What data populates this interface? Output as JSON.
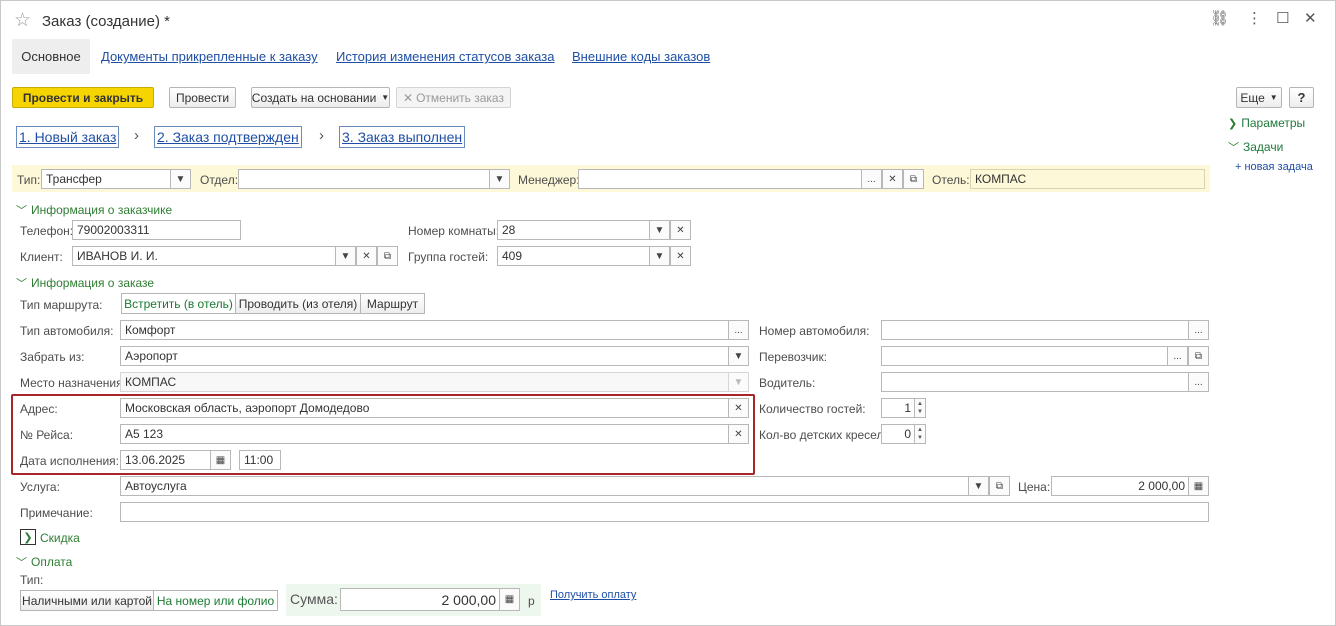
{
  "window": {
    "title": "Заказ (создание) *"
  },
  "tabs": [
    {
      "label": "Основное"
    },
    {
      "label": "Документы прикрепленные к заказу"
    },
    {
      "label": "История изменения статусов заказа"
    },
    {
      "label": "Внешние коды заказов"
    }
  ],
  "toolbar": {
    "post_close": "Провести и закрыть",
    "post": "Провести",
    "create_based": "Создать на основании",
    "cancel_order": "Отменить заказ",
    "more": "Еще",
    "help": "?"
  },
  "steps": [
    "1. Новый заказ",
    "2. Заказ подтвержден",
    "3. Заказ выполнен"
  ],
  "side_panel": {
    "params": "Параметры",
    "tasks": "Задачи",
    "new_task": "+ новая задача"
  },
  "header_fields": {
    "type_label": "Тип:",
    "type_value": "Трансфер",
    "dept_label": "Отдел:",
    "dept_value": "",
    "manager_label": "Менеджер:",
    "manager_value": "",
    "hotel_label": "Отель:",
    "hotel_value": "КОМПАС"
  },
  "customer": {
    "group_title": "Информация о заказчике",
    "phone_label": "Телефон:",
    "phone_value": "79002003311",
    "client_label": "Клиент:",
    "client_value": "ИВАНОВ И. И.",
    "room_label": "Номер комнаты:",
    "room_value": "28",
    "guest_group_label": "Группа гостей:",
    "guest_group_value": "409"
  },
  "order": {
    "group_title": "Информация о заказе",
    "route_type_label": "Тип маршрута:",
    "route_options": [
      "Встретить (в отель)",
      "Проводить (из отеля)",
      "Маршрут"
    ],
    "car_type_label": "Тип автомобиля:",
    "car_type_value": "Комфорт",
    "pickup_label": "Забрать из:",
    "pickup_value": "Аэропорт",
    "destination_label": "Место назначения:",
    "destination_value": "КОМПАС",
    "address_label": "Адрес:",
    "address_value": "Московская область, аэропорт Домодедово",
    "flight_label": "№ Рейса:",
    "flight_value": "А5 123",
    "date_label": "Дата исполнения:",
    "date_value": "13.06.2025",
    "time_value": "11:00",
    "car_number_label": "Номер автомобиля:",
    "car_number_value": "",
    "carrier_label": "Перевозчик:",
    "carrier_value": "",
    "driver_label": "Водитель:",
    "driver_value": "",
    "guests_count_label": "Количество гостей:",
    "guests_count_value": "1",
    "child_seats_label": "Кол-во детских кресел:",
    "child_seats_value": "0",
    "service_label": "Услуга:",
    "service_value": "Автоуслуга",
    "price_label": "Цена:",
    "price_value": "2 000,00",
    "note_label": "Примечание:",
    "note_value": "",
    "discount_label": "Скидка"
  },
  "payment": {
    "group_title": "Оплата",
    "type_label": "Тип:",
    "type_options": [
      "Наличными или картой",
      "На номер или фолио"
    ],
    "sum_label": "Сумма:",
    "sum_value": "2 000,00",
    "currency": "р",
    "get_payment": "Получить оплату"
  },
  "icons": {
    "dropdown": "▾",
    "clear": "×",
    "open": "⧉",
    "select": "...",
    "calendar": "▦",
    "calculator": "▦",
    "star": "☆",
    "link": "🔗",
    "menu": "⋮",
    "maximize": "☐",
    "close": "✕"
  }
}
